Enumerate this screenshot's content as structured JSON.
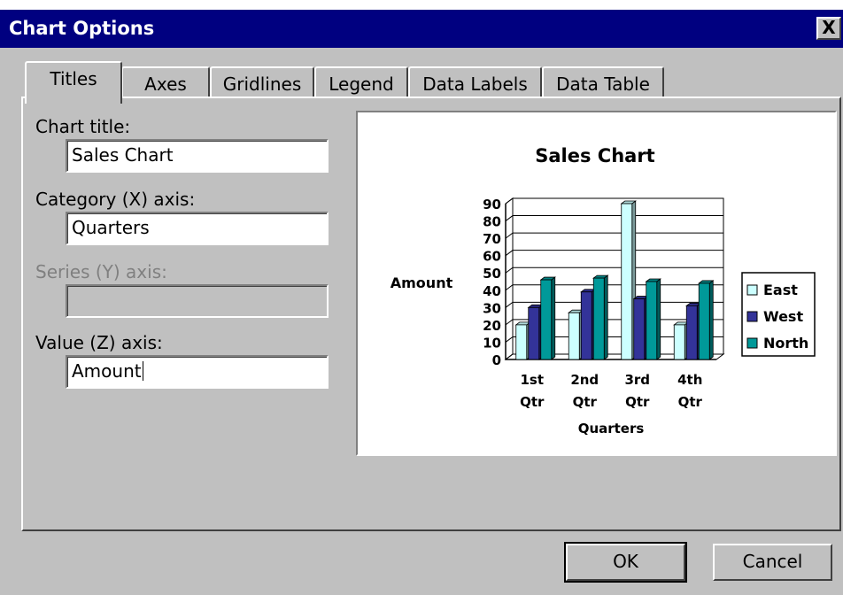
{
  "window": {
    "title": "Chart Options",
    "close_symbol": "X"
  },
  "tabs": [
    "Titles",
    "Axes",
    "Gridlines",
    "Legend",
    "Data Labels",
    "Data Table"
  ],
  "fields": {
    "chart_title": {
      "label": "Chart title:",
      "value": "Sales Chart"
    },
    "category_axis": {
      "label": "Category (X) axis:",
      "value": "Quarters"
    },
    "series_axis": {
      "label": "Series (Y) axis:",
      "value": ""
    },
    "value_axis": {
      "label": "Value (Z) axis:",
      "value": "Amount"
    }
  },
  "buttons": {
    "ok": "OK",
    "cancel": "Cancel"
  },
  "chart_data": {
    "type": "bar",
    "title": "Sales Chart",
    "xlabel": "Quarters",
    "ylabel": "Amount",
    "categories": [
      [
        "1st",
        "Qtr"
      ],
      [
        "2nd",
        "Qtr"
      ],
      [
        "3rd",
        "Qtr"
      ],
      [
        "4th",
        "Qtr"
      ]
    ],
    "series": [
      {
        "name": "East",
        "values": [
          20,
          27,
          90,
          20
        ],
        "color": "#ccffff"
      },
      {
        "name": "West",
        "values": [
          30,
          39,
          35,
          31
        ],
        "color": "#333399"
      },
      {
        "name": "North",
        "values": [
          46,
          47,
          45,
          44
        ],
        "color": "#009999"
      }
    ],
    "yticks": [
      0,
      10,
      20,
      30,
      40,
      50,
      60,
      70,
      80,
      90
    ],
    "ylim": [
      0,
      90
    ],
    "grid": true,
    "legend_position": "right"
  }
}
